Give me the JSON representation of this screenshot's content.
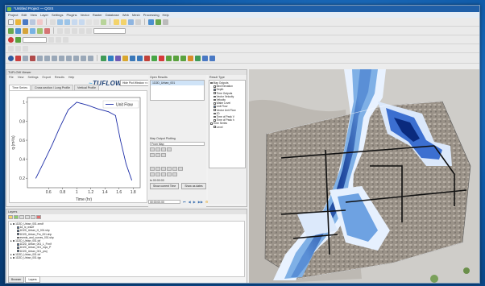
{
  "window": {
    "title": "*Untitled Project — QGIS"
  },
  "menubar": [
    "Project",
    "Edit",
    "View",
    "Layer",
    "Settings",
    "Plugins",
    "Vector",
    "Raster",
    "Database",
    "Web",
    "Mesh",
    "Processing",
    "Help"
  ],
  "viewer": {
    "dock_title": "TUFLOW Viewer",
    "menu": [
      "File",
      "View",
      "Settings",
      "Export",
      "Results",
      "Help"
    ],
    "tabs": [
      "Time Series",
      "Cross section / Long Profile",
      "Vertical Profile"
    ],
    "logo_text": "TUFLOW",
    "plot_toggle": "Hide Plot Window <<"
  },
  "results": {
    "open_results_label": "Open Results",
    "open_results_items": [
      "1D2D_Urban_001"
    ],
    "output_plotting_label": "Map Output Plotting",
    "from_map": "From Map",
    "time_label": "ts 00:00:00",
    "btn_plot_current": "Show current Time",
    "btn_show_as_dates": "Show as dates",
    "time_value": "00:00:00.00"
  },
  "result_types": {
    "label": "Result Type",
    "items": [
      {
        "text": "Map Outputs",
        "checked": false,
        "group": true
      },
      {
        "text": "Bed Elevation",
        "checked": false
      },
      {
        "text": "Depth",
        "checked": true
      },
      {
        "text": "Time Outputs",
        "checked": false
      },
      {
        "text": "Vector Velocity",
        "checked": false
      },
      {
        "text": "Velocity",
        "checked": false
      },
      {
        "text": "Water Level",
        "checked": false
      },
      {
        "text": "Unit Flow",
        "checked": true
      },
      {
        "text": "Vector Unit Flow",
        "checked": false
      },
      {
        "text": "Z0",
        "checked": false
      },
      {
        "text": "Time of Peak V",
        "checked": false
      },
      {
        "text": "Time of Peak h",
        "checked": false
      },
      {
        "text": "Time Series",
        "checked": false,
        "group": true
      },
      {
        "text": "Level",
        "checked": false
      }
    ]
  },
  "layers": {
    "title": "Layers",
    "items": [
      {
        "text": "1D2D_Urban_001.xmdf",
        "indent": 0
      },
      {
        "text": "1d_lc_wsurf",
        "indent": 1
      },
      {
        "text": "1D2D_Urban_H_001.shp",
        "indent": 1
      },
      {
        "text": "1D2D_Urban_Pm_001.shp",
        "indent": 1
      },
      {
        "text": "events_and_curves_001.shp",
        "indent": 1
      },
      {
        "text": "1D2D_Urban_001.tcf",
        "indent": 0
      },
      {
        "text": "1D2D_Urban_001_L_P.mif",
        "indent": 1
      },
      {
        "text": "1D2D_Urban_001_mpc_P",
        "indent": 1
      },
      {
        "text": "1D2D_Urban_001_proj",
        "indent": 1
      },
      {
        "text": "1D2D_Urban_001.tcf",
        "indent": 0
      },
      {
        "text": "1D2D_Urban_001.tgc",
        "indent": 0
      }
    ],
    "bottom_tabs": [
      "Browser",
      "Layers"
    ]
  },
  "chart_data": {
    "type": "line",
    "title": "",
    "xlabel": "Time (hr)",
    "ylabel": "q (m²/s)",
    "xlim": [
      0.3,
      1.9
    ],
    "ylim": [
      0.1,
      1.05
    ],
    "xticks": [
      0.6,
      0.8,
      1.0,
      1.2,
      1.4,
      1.6,
      1.8
    ],
    "yticks": [
      0.2,
      0.4,
      0.6,
      0.8,
      1.0
    ],
    "legend_position": "top-right",
    "series": [
      {
        "name": "Unit Flow",
        "color": "#1f2fa8",
        "x": [
          0.42,
          0.52,
          0.65,
          0.75,
          0.88,
          1.0,
          1.15,
          1.3,
          1.45,
          1.55,
          1.62,
          1.7,
          1.78
        ],
        "y": [
          0.2,
          0.35,
          0.55,
          0.72,
          0.92,
          1.0,
          0.97,
          0.93,
          0.9,
          0.86,
          0.6,
          0.35,
          0.18
        ]
      }
    ]
  }
}
